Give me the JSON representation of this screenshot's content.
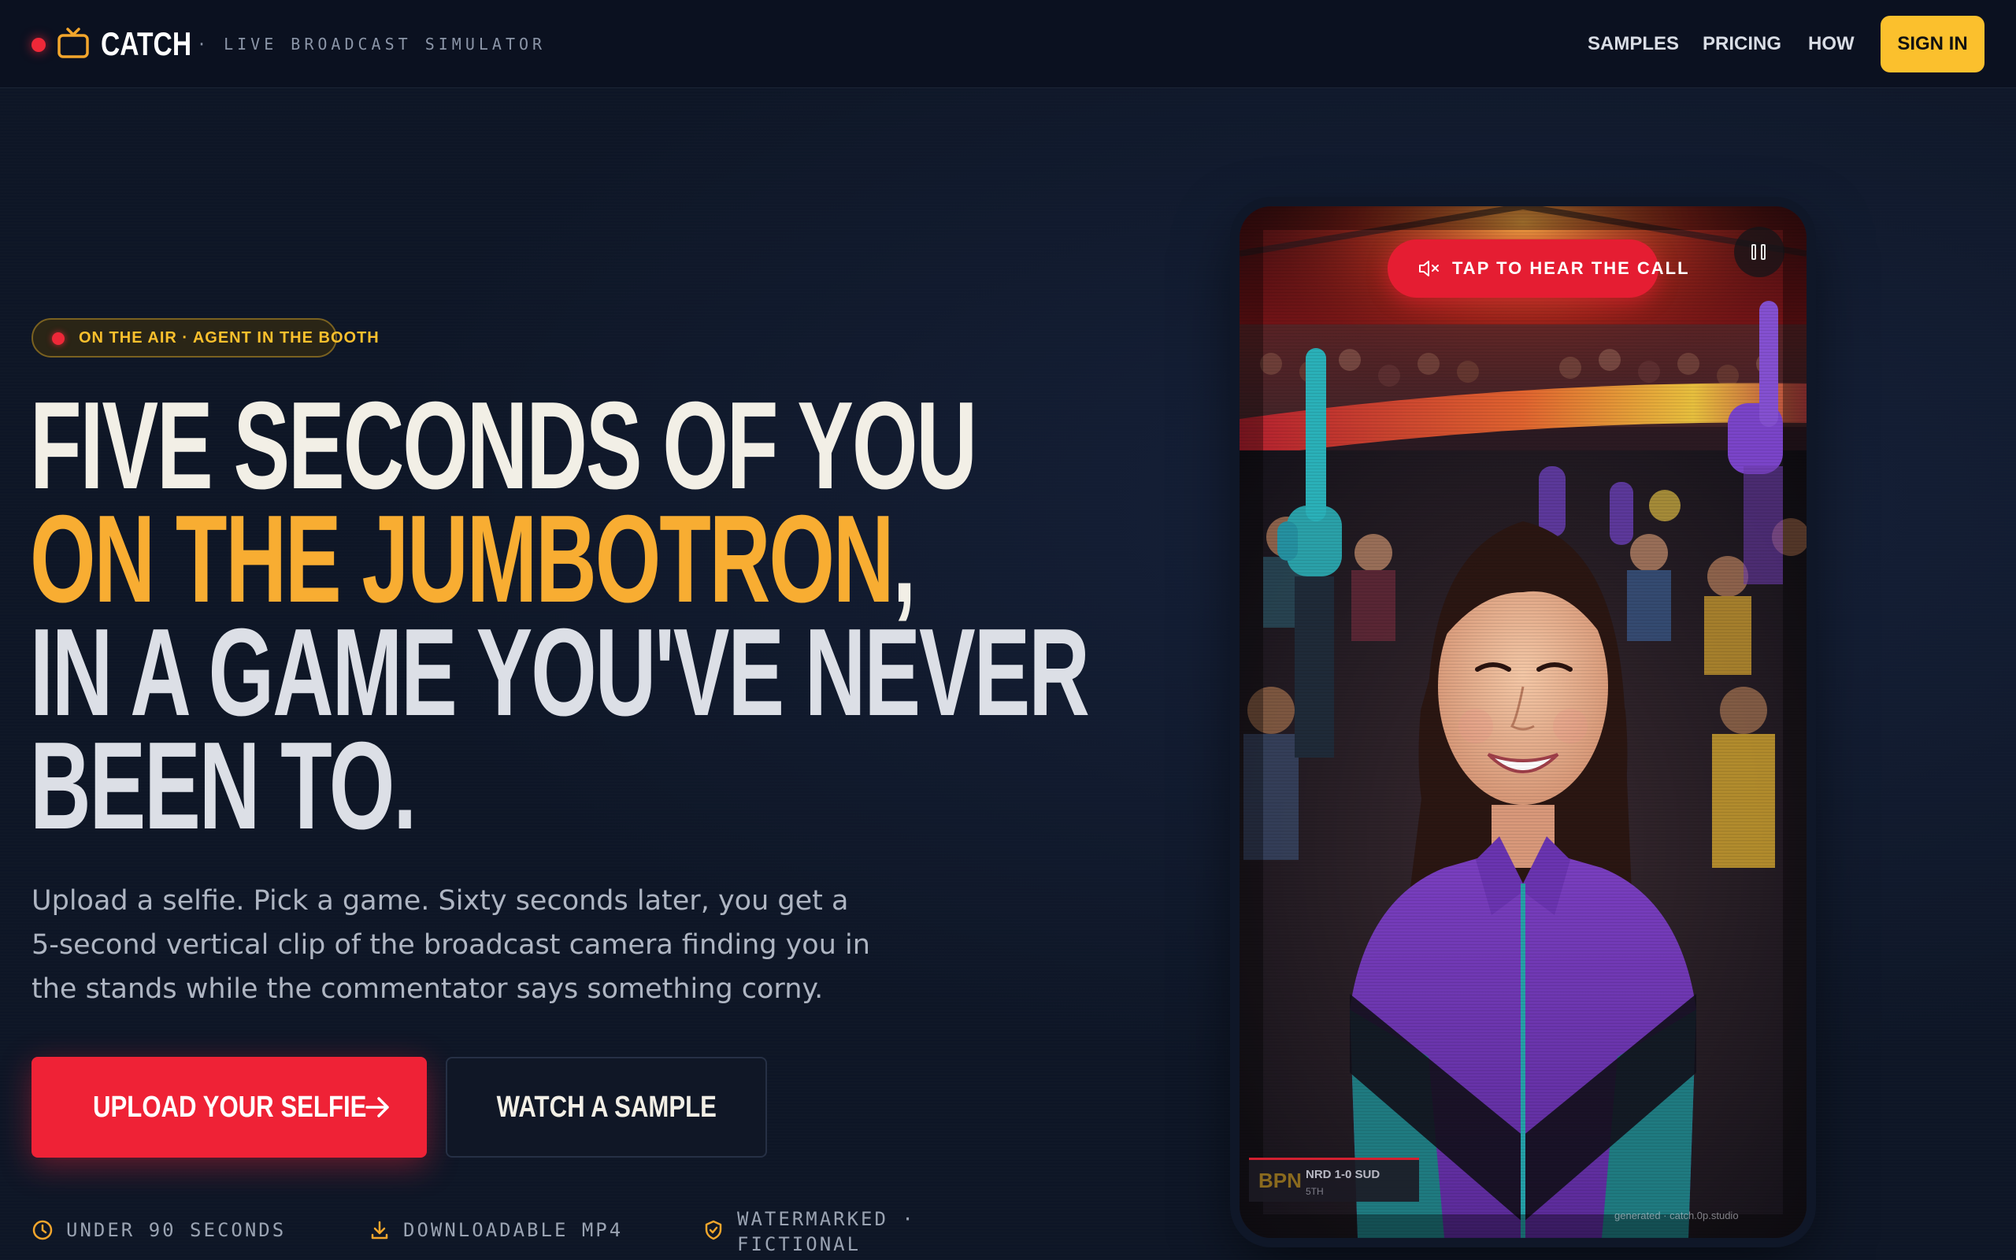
{
  "header": {
    "brand": "CATCH",
    "tagline": "· LIVE BROADCAST SIMULATOR",
    "nav": [
      {
        "label": "SAMPLES"
      },
      {
        "label": "PRICING"
      },
      {
        "label": "HOW"
      }
    ],
    "sign_in_label": "SIGN IN"
  },
  "hero": {
    "badge": "ON THE AIR · AGENT IN THE BOOTH",
    "headline": {
      "line1": "FIVE SECONDS OF YOU",
      "line2_accent": "ON THE JUMBOTRON",
      "line2_comma": ",",
      "line3": "IN A GAME YOU'VE NEVER",
      "line4": "BEEN TO."
    },
    "subcopy": "Upload a selfie. Pick a game. Sixty seconds later, you get a 5-second vertical clip of the broadcast camera finding you in the stands while the commentator says something corny.",
    "cta_primary": "UPLOAD YOUR SELFIE",
    "cta_secondary": "WATCH A SAMPLE",
    "features": [
      {
        "icon": "clock-icon",
        "label": "UNDER 90 SECONDS"
      },
      {
        "icon": "download-icon",
        "label": "DOWNLOADABLE MP4"
      },
      {
        "icon": "shield-icon",
        "label": "WATERMARKED ·\nFICTIONAL"
      }
    ]
  },
  "preview": {
    "audio_prompt": "TAP TO HEAR THE CALL",
    "scorebug": {
      "network": "BPN",
      "score": "NRD 1-0 SUD",
      "period": "5TH"
    },
    "watermark": "generated · catch.0p.studio"
  },
  "colors": {
    "background": "#0e1626",
    "accent_red": "#ef2236",
    "accent_yellow": "#fbc02d",
    "headline_orange": "#f8ad32"
  }
}
